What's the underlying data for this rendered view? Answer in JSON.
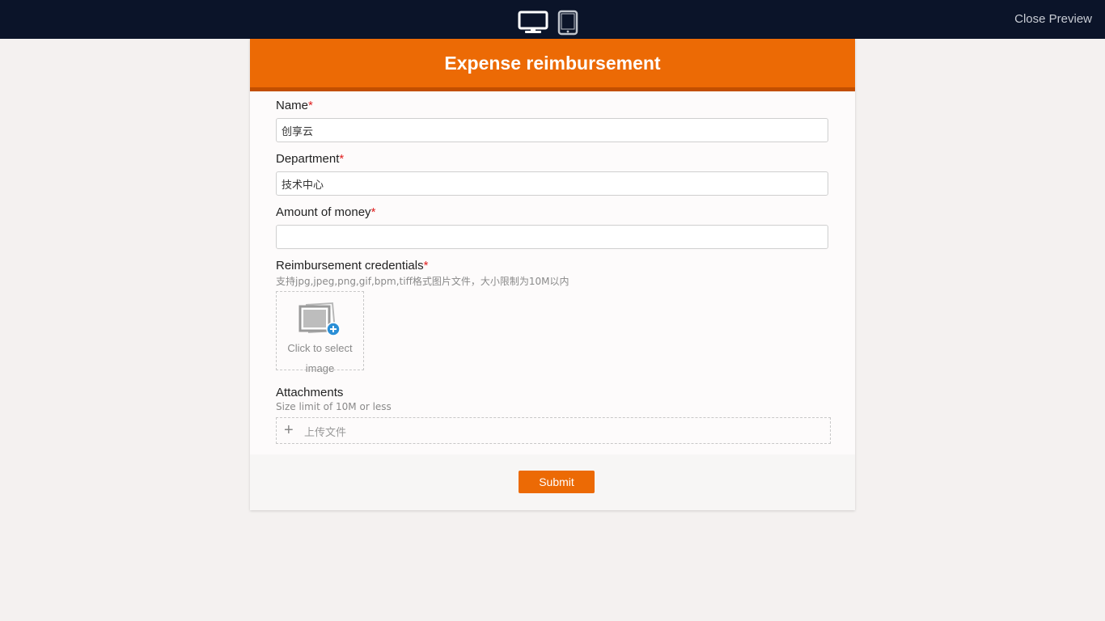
{
  "topbar": {
    "close_label": "Close Preview",
    "icons": [
      "desktop-icon",
      "tablet-icon"
    ],
    "background": "#0b1429"
  },
  "form": {
    "title": "Expense reimbursement",
    "accent_color": "#ec6a05",
    "required_marker": "*",
    "fields": {
      "name": {
        "label": "Name",
        "value": "创享云"
      },
      "department": {
        "label": "Department",
        "value": "技术中心"
      },
      "amount": {
        "label": "Amount of money",
        "value": ""
      },
      "credentials": {
        "label": "Reimbursement credentials",
        "hint": "支持jpg,jpeg,png,gif,bpm,tiff格式图片文件，大小限制为10M以内",
        "picker_label": "Click to select image"
      },
      "attachments": {
        "label": "Attachments",
        "hint": "Size limit of 10M or less",
        "upload_label": "上传文件"
      }
    },
    "submit_label": "Submit"
  }
}
